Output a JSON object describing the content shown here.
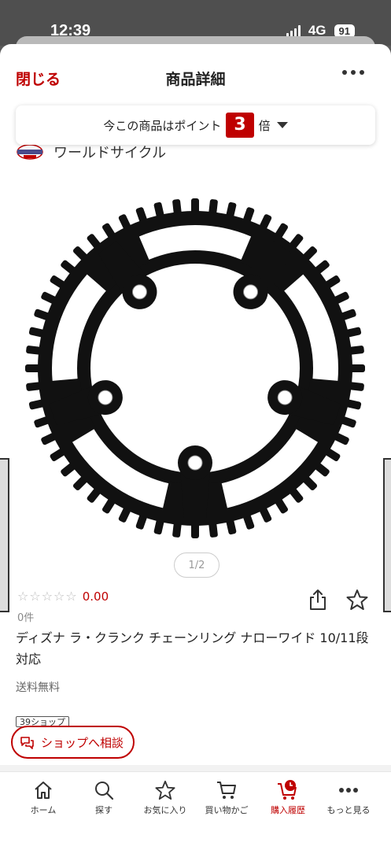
{
  "status": {
    "time": "12:39",
    "network": "4G",
    "battery": "91"
  },
  "nav": {
    "close_label": "閉じる",
    "title": "商品詳細"
  },
  "points": {
    "prefix": "今この商品はポイント",
    "multiplier": "3",
    "suffix": "倍"
  },
  "shop": {
    "name": "ワールドサイクル"
  },
  "gallery": {
    "pager": "1/2"
  },
  "rating": {
    "stars": "☆☆☆☆☆",
    "value": "0.00",
    "review_count": "0件"
  },
  "product": {
    "title": "ディズナ ラ・クランク チェーンリング ナローワイド 10/11段対応",
    "shipping": "送料無料",
    "tag": "39ショップ"
  },
  "consult": {
    "label": "ショップへ相談"
  },
  "tabbar": {
    "items": [
      {
        "label": "ホーム",
        "icon": "home-icon"
      },
      {
        "label": "探す",
        "icon": "search-icon"
      },
      {
        "label": "お気に入り",
        "icon": "star-icon"
      },
      {
        "label": "買い物かご",
        "icon": "cart-icon"
      },
      {
        "label": "購入履歴",
        "icon": "purchase-history-icon"
      },
      {
        "label": "もっと見る",
        "icon": "more-icon"
      }
    ]
  },
  "colors": {
    "accent": "#bf0000"
  }
}
